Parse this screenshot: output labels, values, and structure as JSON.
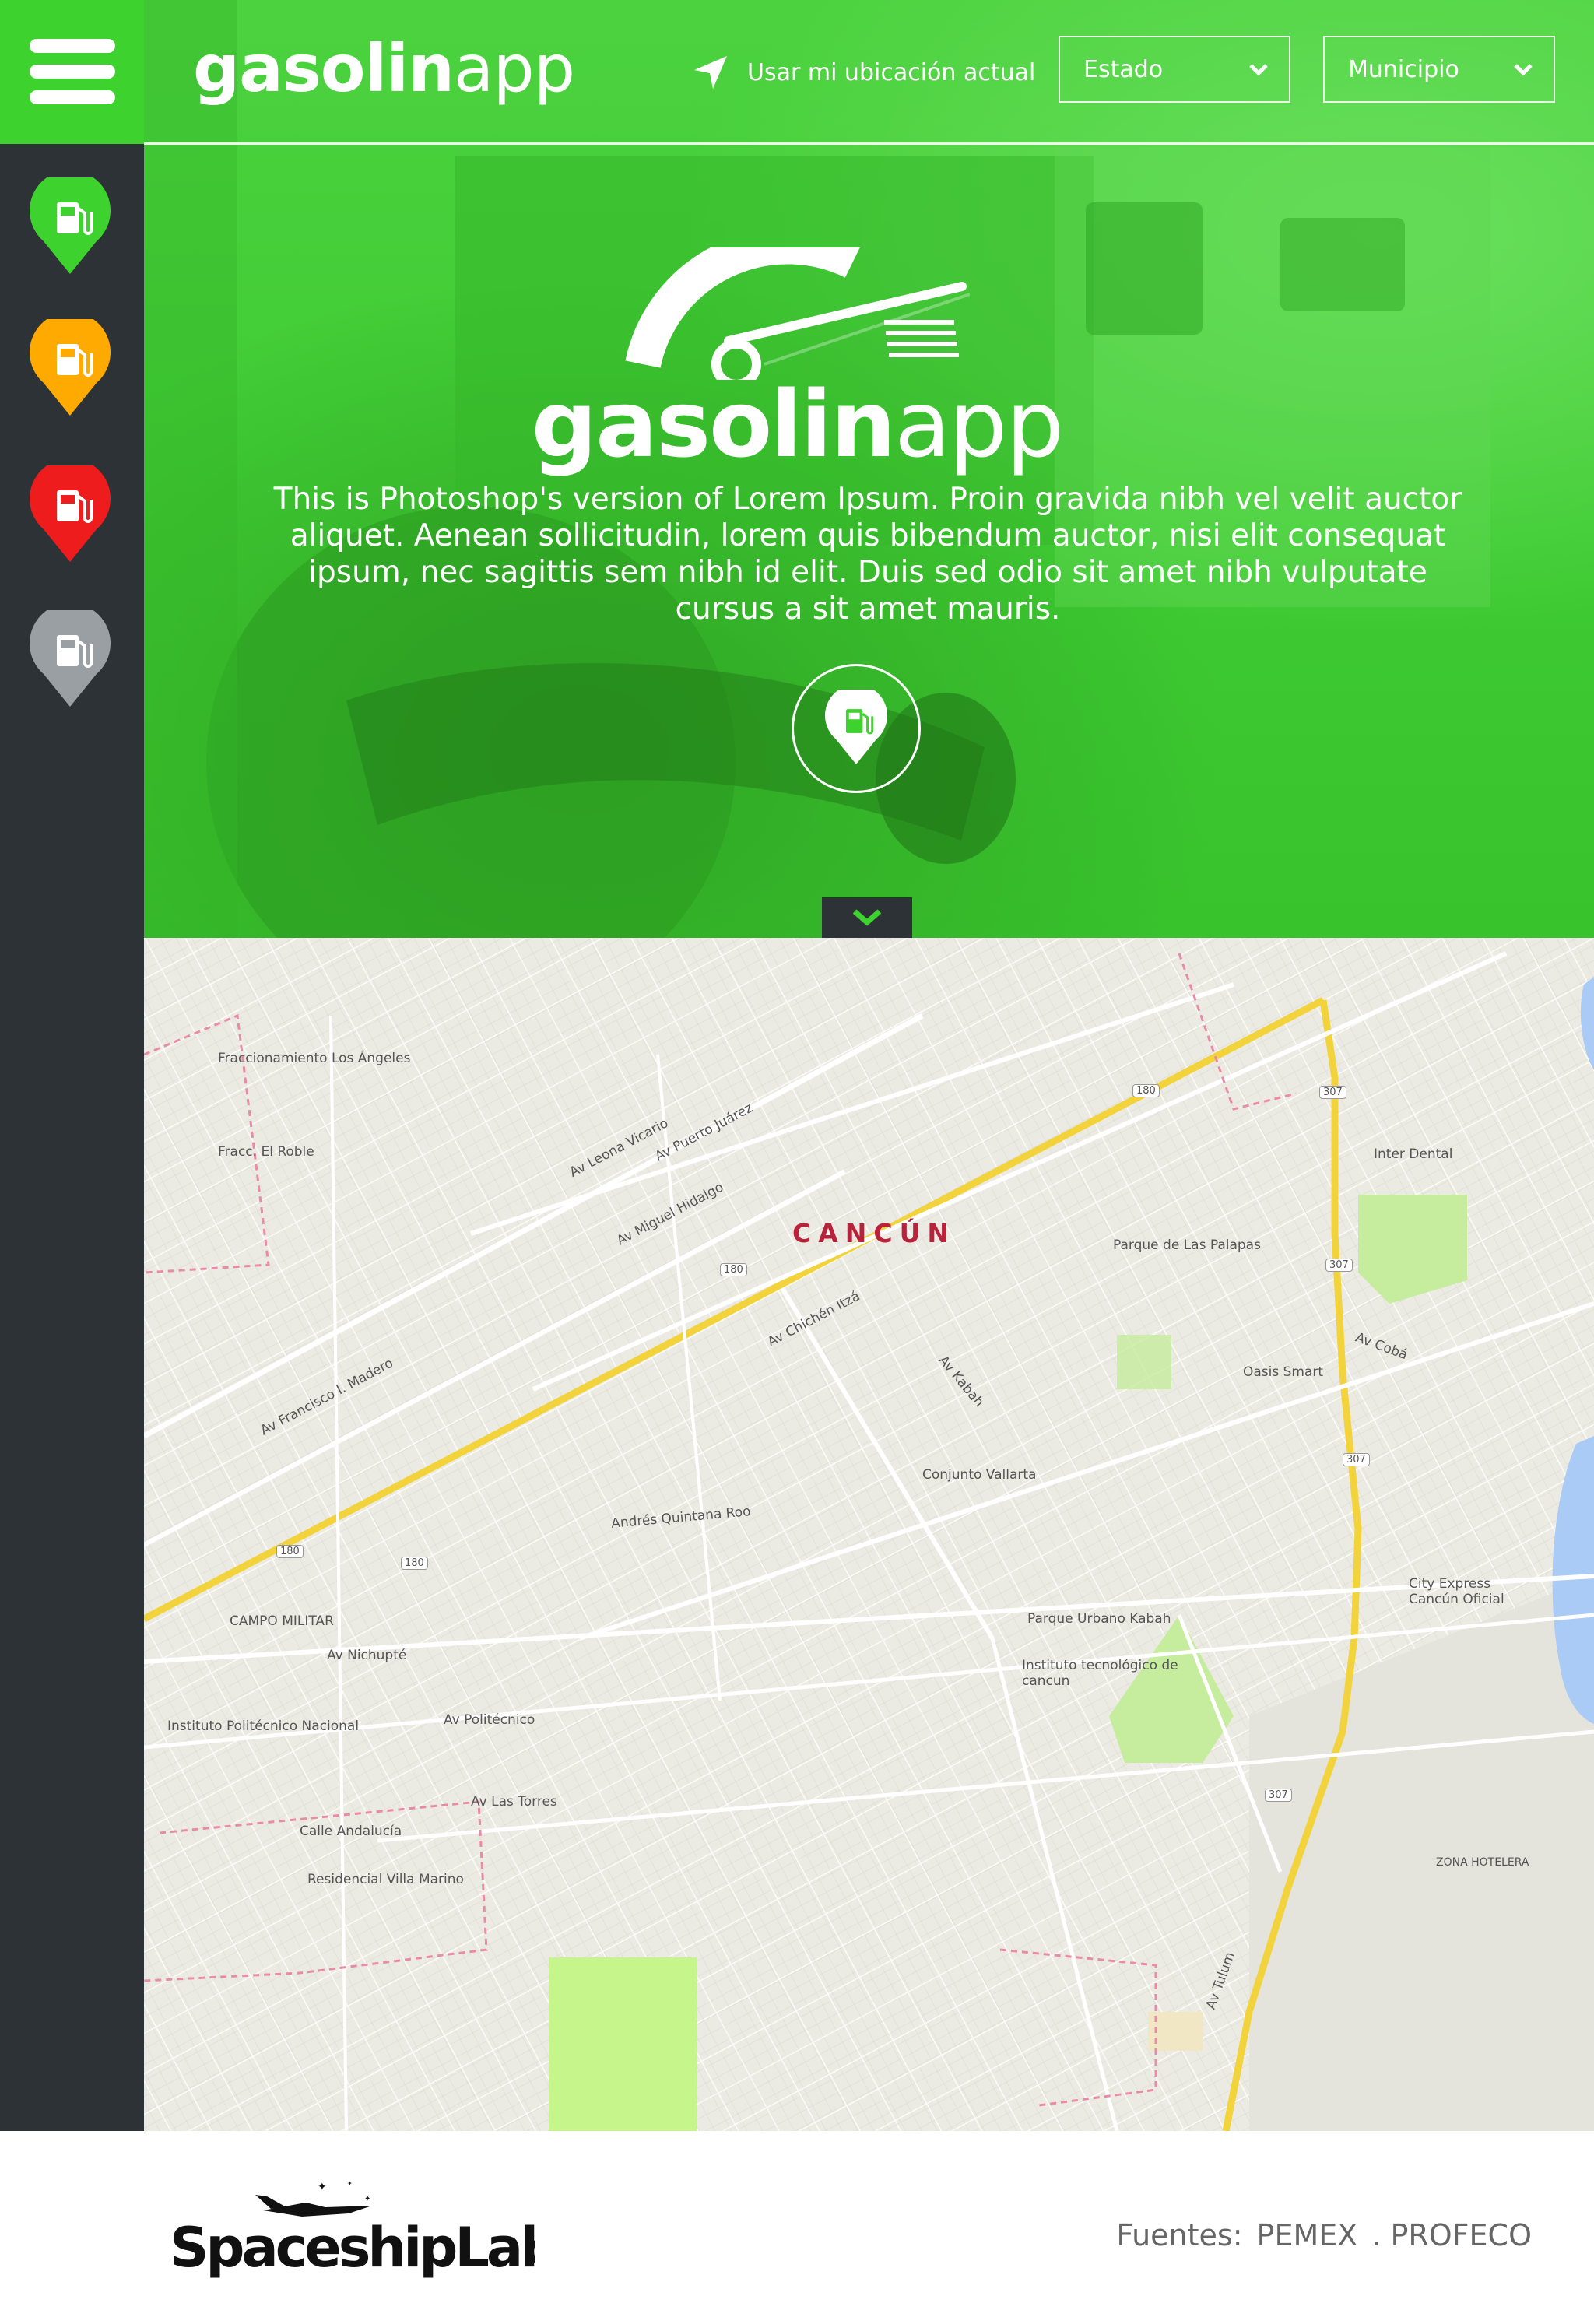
{
  "app": {
    "brand_bold": "gasolin",
    "brand_light": "app"
  },
  "header": {
    "location_label": "Usar mi ubicación actual",
    "state_select": "Estado",
    "municipality_select": "Municipio"
  },
  "sidebar": {
    "pins": [
      {
        "name": "gas-pin-green",
        "color": "#3dd22d"
      },
      {
        "name": "gas-pin-orange",
        "color": "#ffaa00"
      },
      {
        "name": "gas-pin-red",
        "color": "#ee1c1c"
      },
      {
        "name": "gas-pin-gray",
        "color": "#9a9fa3"
      }
    ]
  },
  "hero": {
    "title_bold": "gasolin",
    "title_light": "app",
    "description": "This is Photoshop's version  of Lorem Ipsum. Proin gravida nibh vel velit auctor aliquet. Aenean sollicitudin, lorem quis bibendum auctor, nisi elit consequat ipsum, nec sagittis sem nibh id elit. Duis sed odio sit amet nibh vulputate cursus a sit amet mauris."
  },
  "map": {
    "city": "CANCÚN",
    "labels": [
      "Fraccionamiento Los Ángeles",
      "Fracc. El Roble",
      "Av Leona Vicario",
      "Av Puerto Juárez",
      "Av Miguel Hidalgo",
      "Av Chichén Itzá",
      "Parque de Las Palapas",
      "Av Cobá",
      "Oasis Smart",
      "Conjunto Vallarta",
      "Andrés Quintana Roo",
      "CAMPO MILITAR",
      "Av Nichupté",
      "Av Politécnico",
      "Parque Urbano Kabah",
      "Instituto tecnológico de cancun",
      "City Express Cancún Oficial",
      "Av Las Torres",
      "Residencial Villa Marino",
      "ZONA HOTELERA",
      "Inter Dental",
      "Calle Andalucía",
      "Av Tulum",
      "Av Kabah",
      "Instituto Politécnico Nacional",
      "Av Francisco I. Madero"
    ],
    "road_shields": [
      "180",
      "180",
      "180",
      "180",
      "307",
      "307",
      "307",
      "307"
    ]
  },
  "footer": {
    "company": "SpaceshipLabs",
    "sources_label": "Fuentes:",
    "sources": [
      "PEMEX",
      ". PROFECO"
    ]
  },
  "colors": {
    "accent": "#3dd22d",
    "rail": "#2c3236",
    "map_highway": "#f3d23a"
  }
}
